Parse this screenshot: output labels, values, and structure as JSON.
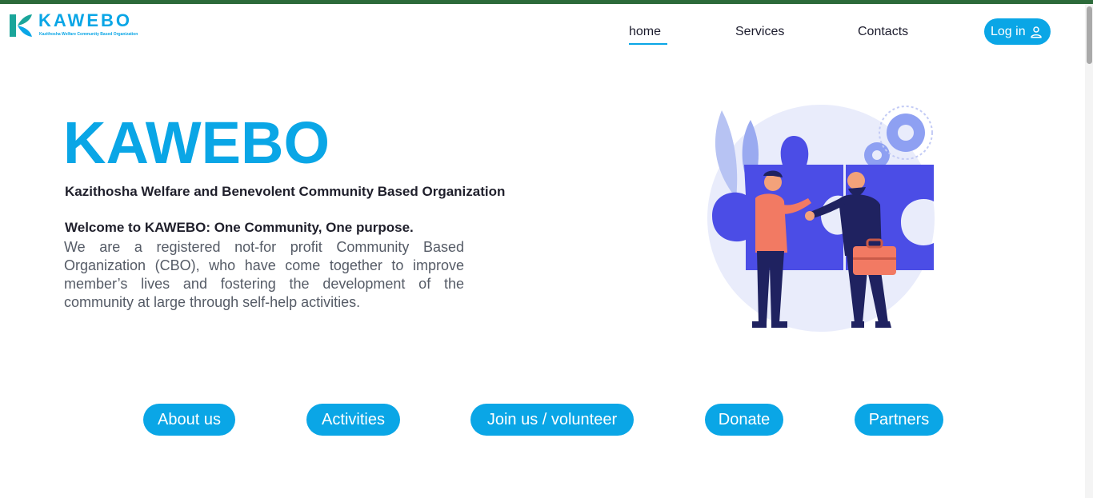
{
  "header": {
    "logo": {
      "word": "KAWEBO",
      "tagline": "Kazithosha Welfare Community Based Organization"
    },
    "nav": {
      "home": "home",
      "services": "Services",
      "contacts": "Contacts"
    },
    "login_label": "Log in",
    "login_icon": "user-icon"
  },
  "hero": {
    "title": "KAWEBO",
    "subtitle": "Kazithosha Welfare and Benevolent Community Based Organization",
    "welcome": "Welcome to KAWEBO: One Community, One purpose.",
    "description": "We are a registered not-for profit Community Based Organization (CBO), who have come together to improve member’s lives and fostering the development of the community at large through self-help activities.",
    "illustration": "handshake-puzzle-illustration"
  },
  "actions": {
    "about": "About us",
    "activities": "Activities",
    "join": "Join us / volunteer",
    "donate": "Donate",
    "partners": "Partners"
  },
  "colors": {
    "accent": "#0aa6e6",
    "top_strip": "#2c6a3a",
    "text_dark": "#1f1f2b",
    "text_muted": "#555b66"
  }
}
